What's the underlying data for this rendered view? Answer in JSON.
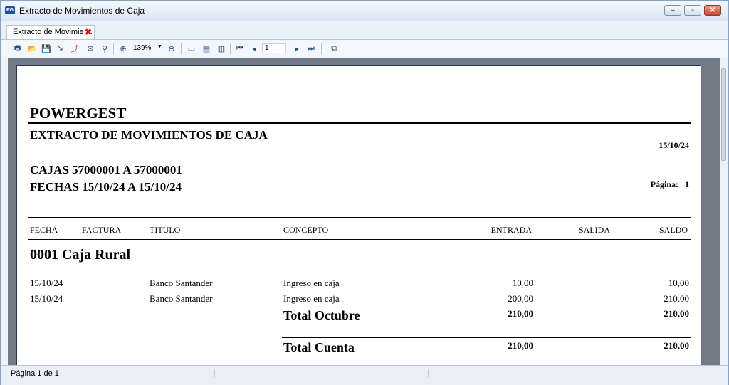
{
  "window": {
    "title": "Extracto de Movimientos de Caja",
    "app_icon": "PG"
  },
  "tab": {
    "label": "Extracto de Movimie ..."
  },
  "toolbar": {
    "zoom": "139%",
    "page_input": "1"
  },
  "report": {
    "company": "POWERGEST",
    "title": "EXTRACTO DE MOVIMIENTOS DE CAJA",
    "date": "15/10/24",
    "range_cajas": "CAJAS 57000001 A 57000001",
    "range_fechas": "FECHAS 15/10/24 A 15/10/24",
    "page_label": "Página:",
    "page_number": "1",
    "columns": {
      "fecha": "FECHA",
      "factura": "FACTURA",
      "titulo": "TITULO",
      "concepto": "CONCEPTO",
      "entrada": "ENTRADA",
      "salida": "SALIDA",
      "saldo": "SALDO"
    },
    "account": "0001  Caja Rural",
    "rows": [
      {
        "fecha": "15/10/24",
        "factura": "",
        "titulo": "Banco Santander",
        "concepto": "Ingreso en caja",
        "entrada": "10,00",
        "salida": "",
        "saldo": "10,00"
      },
      {
        "fecha": "15/10/24",
        "factura": "",
        "titulo": "Banco Santander",
        "concepto": "Ingreso en caja",
        "entrada": "200,00",
        "salida": "",
        "saldo": "210,00"
      }
    ],
    "total_month": {
      "label": "Total Octubre",
      "entrada": "210,00",
      "saldo": "210,00"
    },
    "total_account": {
      "label": "Total Cuenta",
      "entrada": "210,00",
      "saldo": "210,00"
    }
  },
  "status": {
    "page_info": "Página 1 de 1"
  }
}
